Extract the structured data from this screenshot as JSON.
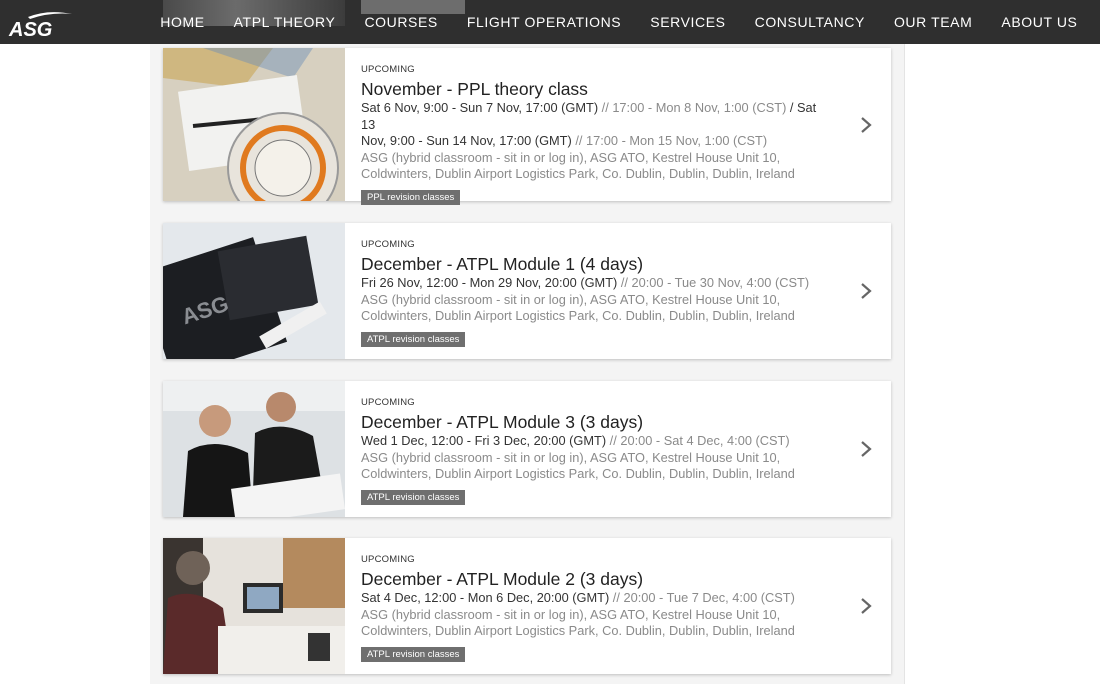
{
  "nav": {
    "logo_text": "ASG",
    "links": [
      "HOME",
      "ATPL THEORY",
      "COURSES",
      "FLIGHT OPERATIONS",
      "SERVICES",
      "CONSULTANCY",
      "OUR TEAM",
      "ABOUT US"
    ]
  },
  "events": [
    {
      "status": "UPCOMING",
      "title": "November - PPL theory class",
      "dates_line1_main": "Sat 6 Nov, 9:00 - Sun 7 Nov, 17:00 (GMT)",
      "dates_line1_alt": " // 17:00 - Mon 8 Nov, 1:00 (CST)",
      "dates_line1_sep": " / Sat 13",
      "dates_line2_main": "Nov, 9:00 - Sun 14 Nov, 17:00 (GMT)",
      "dates_line2_alt": " // 17:00 - Mon 15 Nov, 1:00 (CST)",
      "venue_line1": "ASG (hybrid classroom - sit in or log in), ASG ATO, Kestrel House Unit 10,",
      "venue_line2": "Coldwinters, Dublin Airport Logistics Park, Co. Dublin, Dublin, Dublin, Ireland",
      "tag": "PPL revision classes"
    },
    {
      "status": "UPCOMING",
      "title": "December - ATPL Module 1 (4 days)",
      "dates_main": "Fri 26 Nov, 12:00 - Mon 29 Nov, 20:00 (GMT)",
      "dates_alt": " // 20:00 - Tue 30 Nov, 4:00 (CST)",
      "venue_line1": "ASG (hybrid classroom - sit in or log in), ASG ATO, Kestrel House Unit 10,",
      "venue_line2": "Coldwinters, Dublin Airport Logistics Park, Co. Dublin, Dublin, Dublin, Ireland",
      "tag": "ATPL revision classes"
    },
    {
      "status": "UPCOMING",
      "title": "December - ATPL Module 3 (3 days)",
      "dates_main": "Wed 1 Dec, 12:00 - Fri 3 Dec, 20:00 (GMT)",
      "dates_alt": " // 20:00 - Sat 4 Dec, 4:00 (CST)",
      "venue_line1": "ASG (hybrid classroom - sit in or log in), ASG ATO, Kestrel House Unit 10,",
      "venue_line2": "Coldwinters, Dublin Airport Logistics Park, Co. Dublin, Dublin, Dublin, Ireland",
      "tag": "ATPL revision classes"
    },
    {
      "status": "UPCOMING",
      "title": "December - ATPL Module 2 (3 days)",
      "dates_main": "Sat 4 Dec, 12:00 - Mon 6 Dec, 20:00 (GMT)",
      "dates_alt": " // 20:00 - Tue 7 Dec, 4:00 (CST)",
      "venue_line1": "ASG (hybrid classroom - sit in or log in), ASG ATO, Kestrel House Unit 10,",
      "venue_line2": "Coldwinters, Dublin Airport Logistics Park, Co. Dublin, Dublin, Dublin, Ireland",
      "tag": "ATPL revision classes"
    }
  ],
  "colors": {
    "navbar_bg": "#2f2f2f",
    "page_bg": "#f4f4f4",
    "tag_bg": "#6f6f6f",
    "muted_text": "#8a8a8a"
  },
  "icons": {
    "card_arrow": "chevron-right-icon"
  }
}
